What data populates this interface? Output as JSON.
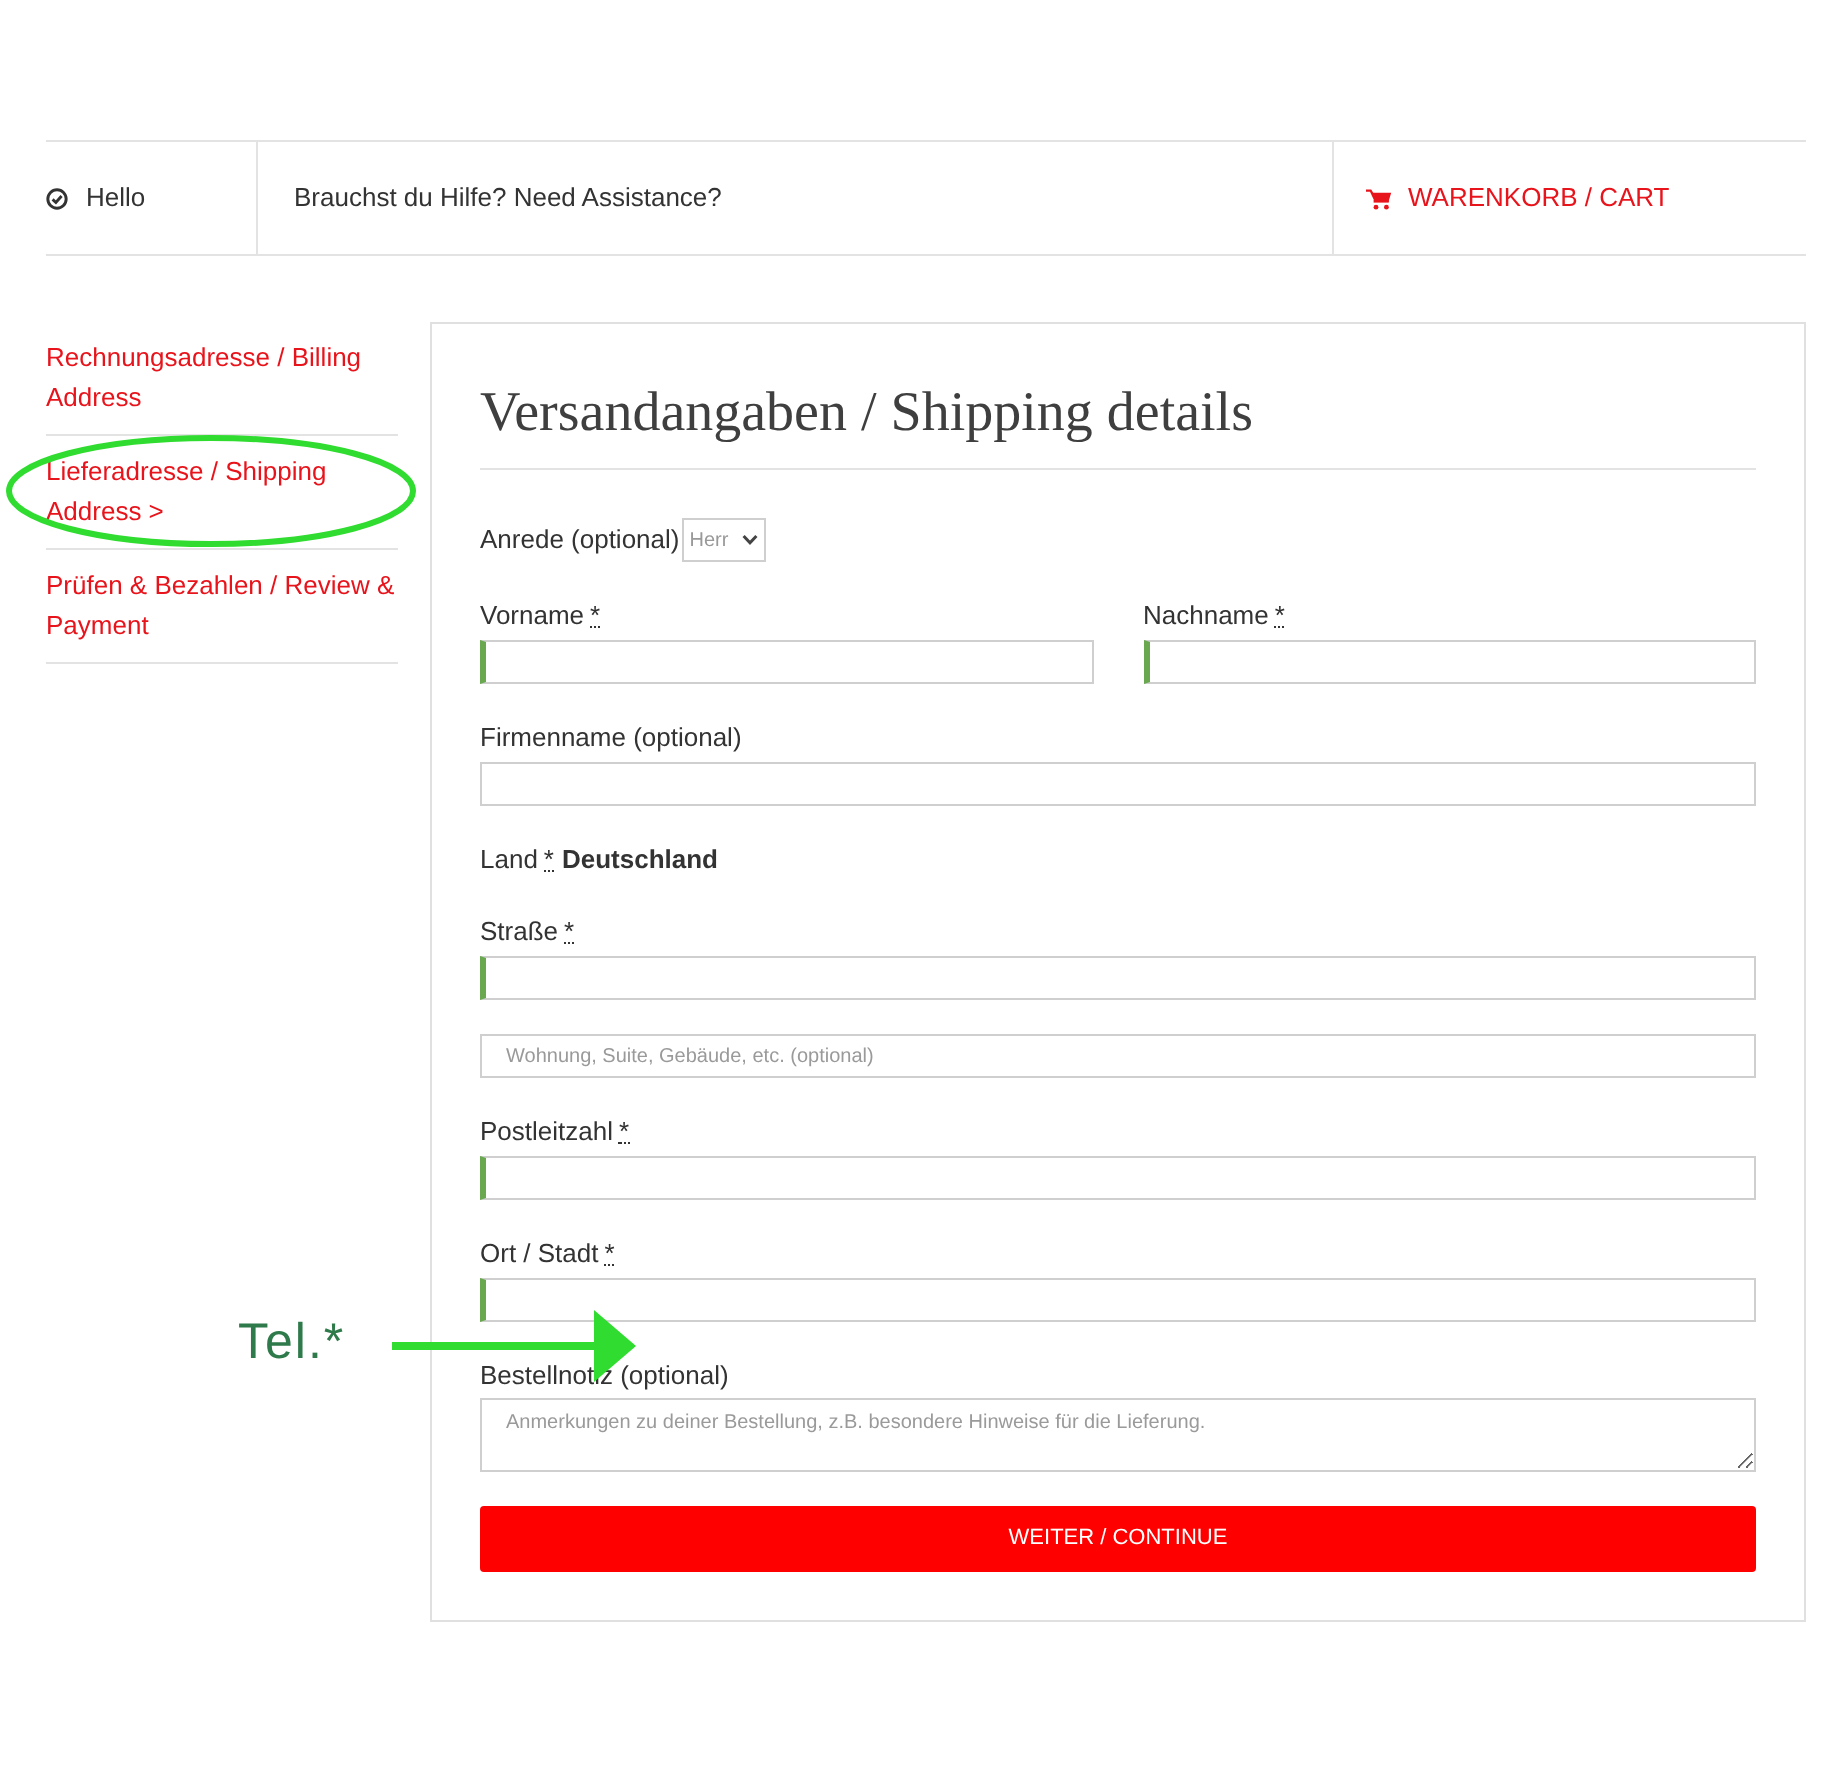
{
  "header": {
    "greeting": "Hello",
    "help_text": "Brauchst du Hilfe? Need Assistance?",
    "cart_link": "WARENKORB / CART"
  },
  "steps": [
    {
      "label": "Rechnungsadresse / Billing Address",
      "highlighted": false
    },
    {
      "label": "Lieferadresse / Shipping Address >",
      "highlighted": true
    },
    {
      "label": "Prüfen & Bezahlen / Review & Payment",
      "highlighted": false
    }
  ],
  "form": {
    "title": "Versandangaben / Shipping details",
    "rows": [
      {
        "fields": [
          {
            "kind": "select",
            "label": "Anrede (optional)",
            "value": "Herr"
          }
        ]
      },
      {
        "fields": [
          {
            "kind": "text",
            "label": "Vorname",
            "required_mark": "*",
            "required": true
          },
          {
            "kind": "text",
            "label": "Nachname",
            "required_mark": "*",
            "required": true
          }
        ]
      },
      {
        "fields": [
          {
            "kind": "text",
            "label": "Firmenname (optional)",
            "required": false
          }
        ]
      },
      {
        "fields": [
          {
            "kind": "static",
            "label": "Land",
            "required_mark": "*",
            "value": "Deutschland"
          }
        ]
      },
      {
        "fields": [
          {
            "kind": "text",
            "label": "Straße",
            "required_mark": "*",
            "required": true
          }
        ]
      },
      {
        "fields": [
          {
            "kind": "text",
            "placeholder": "Wohnung, Suite, Gebäude, etc. (optional)",
            "required": false
          }
        ]
      },
      {
        "fields": [
          {
            "kind": "text",
            "label": "Postleitzahl",
            "required_mark": "*",
            "required": true
          }
        ]
      },
      {
        "fields": [
          {
            "kind": "text",
            "label": "Ort / Stadt",
            "required_mark": "*",
            "required": true
          }
        ]
      },
      {
        "fields": [
          {
            "kind": "textarea",
            "label": "Bestellnotiz (optional)",
            "placeholder": "Anmerkungen zu deiner Bestellung, z.B. besondere Hinweise für die Lieferung."
          }
        ]
      }
    ],
    "submit": "WEITER / CONTINUE"
  },
  "annotation": {
    "text": "Tel.*"
  }
}
